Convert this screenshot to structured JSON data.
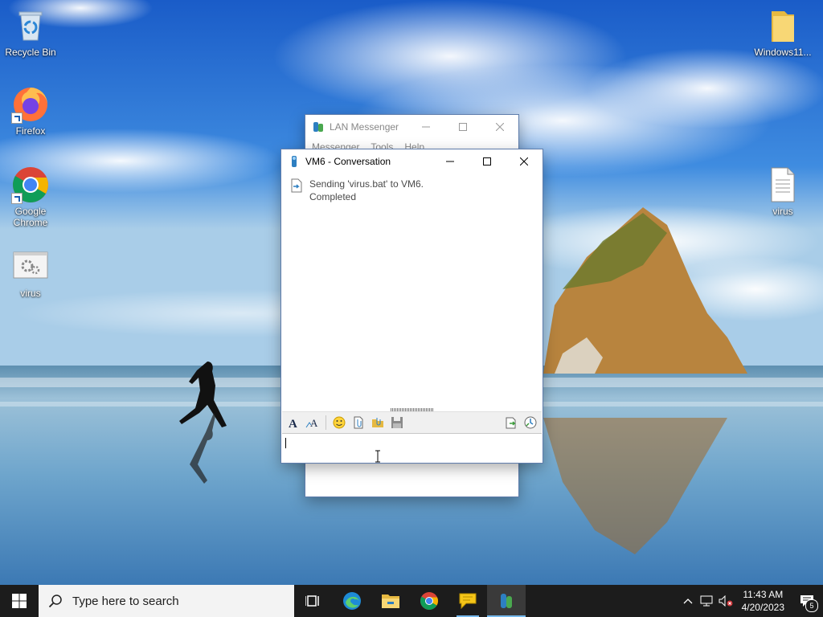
{
  "desktop": {
    "icons_left": [
      {
        "label": "Recycle Bin",
        "icon": "recycle-bin-icon"
      },
      {
        "label": "Firefox",
        "icon": "firefox-icon"
      },
      {
        "label": "Google Chrome",
        "icon": "chrome-icon"
      },
      {
        "label": "virus",
        "icon": "batch-file-icon"
      }
    ],
    "icons_right": [
      {
        "label": "Windows11...",
        "icon": "folder-icon"
      },
      {
        "label": "virus",
        "icon": "text-file-icon"
      }
    ]
  },
  "lan_messenger": {
    "title": "LAN Messenger",
    "menu": [
      "Messenger",
      "Tools",
      "Help"
    ]
  },
  "conversation": {
    "title": "VM6 - Conversation",
    "message_line1": "Sending 'virus.bat' to VM6.",
    "message_line2": "Completed",
    "input_value": "",
    "toolbar": [
      "font-icon",
      "font-color-icon",
      "emoticon-icon",
      "send-file-icon",
      "send-folder-icon",
      "save-icon",
      "history-icon",
      "broadcast-icon"
    ]
  },
  "taskbar": {
    "search_placeholder": "Type here to search",
    "apps": [
      "task-view-icon",
      "edge-icon",
      "file-explorer-icon",
      "chrome-icon",
      "lan-messenger-chat-icon",
      "lan-messenger-icon"
    ],
    "time": "11:43 AM",
    "date": "4/20/2023",
    "notification_count": "5"
  },
  "colors": {
    "taskbar": "#1c1c1c",
    "accent": "#76b9ed",
    "sky_top": "#1a5cc8",
    "sea": "#5d9ec9"
  }
}
